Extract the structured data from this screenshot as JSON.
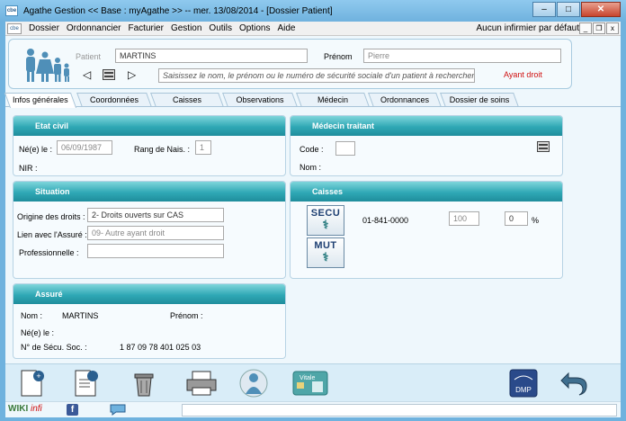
{
  "window": {
    "app_icon_text": "cbe",
    "title": "Agathe Gestion << Base : myAgathe >>   --   mer. 13/08/2014  -  [Dossier Patient]",
    "minimize": "–",
    "maximize": "□",
    "close": "✕"
  },
  "menu": {
    "items": [
      "Dossier",
      "Ordonnancier",
      "Facturier",
      "Gestion",
      "Outils",
      "Options",
      "Aide"
    ],
    "right_text": "Aucun infirmier par défaut",
    "mdi_min": "_",
    "mdi_restore": "❐",
    "mdi_close": "x"
  },
  "patient": {
    "label": "Patient",
    "nom": "MARTINS",
    "prenom_label": "Prénom",
    "prenom": "Pierre",
    "search_placeholder": "Saisissez le nom, le prénom ou le numéro de sécurité sociale d'un patient à rechercher",
    "ayant_droit": "Ayant droit",
    "prev": "◁",
    "next": "▷"
  },
  "tabs": [
    "Infos générales",
    "Coordonnées",
    "Caisses",
    "Observations",
    "Médecin",
    "Ordonnances",
    "Dossier de soins"
  ],
  "etat_civil": {
    "title": "Etat civil",
    "ne_le_label": "Né(e) le :",
    "ne_le": "06/09/1987",
    "rang_label": "Rang de Nais. :",
    "rang": "1",
    "nir_label": "NIR :"
  },
  "medecin": {
    "title": "Médecin traitant",
    "code_label": "Code :",
    "nom_label": "Nom :"
  },
  "situation": {
    "title": "Situation",
    "origine_label": "Origine des droits :",
    "origine": "2- Droits ouverts sur CAS",
    "lien_label": "Lien avec l'Assuré :",
    "lien": "09- Autre ayant droit",
    "pro_label": "Professionnelle :"
  },
  "caisses": {
    "title": "Caisses",
    "secu_label": "SECU",
    "mut_label": "MUT",
    "code": "01-841-0000",
    "taux": "100",
    "pct": "0",
    "pct_sign": "%"
  },
  "assure": {
    "title": "Assuré",
    "nom_label": "Nom :",
    "nom": "MARTINS",
    "prenom_label": "Prénom :",
    "ne_label": "Né(e) le :",
    "secu_label": "N° de Sécu. Soc. :",
    "secu": "1 87 09 78 401 025   03"
  },
  "statusbar": {
    "wiki": "WIKI",
    "infi": "infi",
    "fb": "f"
  },
  "toolbar": {
    "vitale_label": "Vitale",
    "dmp_label": "DMP"
  }
}
